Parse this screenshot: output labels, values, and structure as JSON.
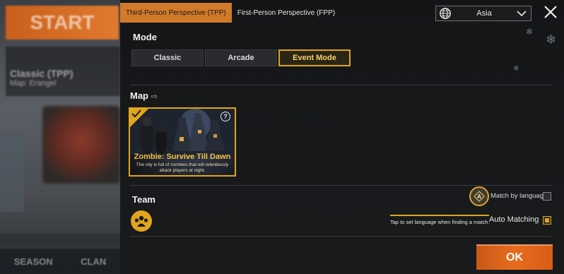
{
  "background": {
    "start_label": "START",
    "mode_label": "Classic (TPP)",
    "map_label": "Map: Erangel",
    "bottom_left": "SEASON",
    "bottom_right": "CLAN"
  },
  "tabs": [
    {
      "label": "Third-Person Perspective (TPP)",
      "active": true
    },
    {
      "label": "First-Person Perspective (FPP)",
      "active": false
    }
  ],
  "region": {
    "label": "Asia",
    "icon": "globe-icon"
  },
  "mode": {
    "section_label": "Mode",
    "options": [
      {
        "label": "Classic",
        "active": false
      },
      {
        "label": "Arcade",
        "active": false
      },
      {
        "label": "Event Mode",
        "active": true
      }
    ]
  },
  "map": {
    "section_label": "Map",
    "card": {
      "title": "Zombie: Survive Till Dawn",
      "description": "The city is full of zombies that will relentlessly attack players at night.",
      "help": "?"
    }
  },
  "team": {
    "section_label": "Team",
    "match_by_language": "Match by language",
    "tooltip": "Tap to set language when finding a match.",
    "auto_matching": "Auto Matching",
    "auto_matching_checked": true,
    "match_by_language_checked": false
  },
  "ok_label": "OK",
  "colors": {
    "accent": "#e0a51c",
    "ok": "#e66c1e",
    "tab_active": "#d27a2a"
  }
}
